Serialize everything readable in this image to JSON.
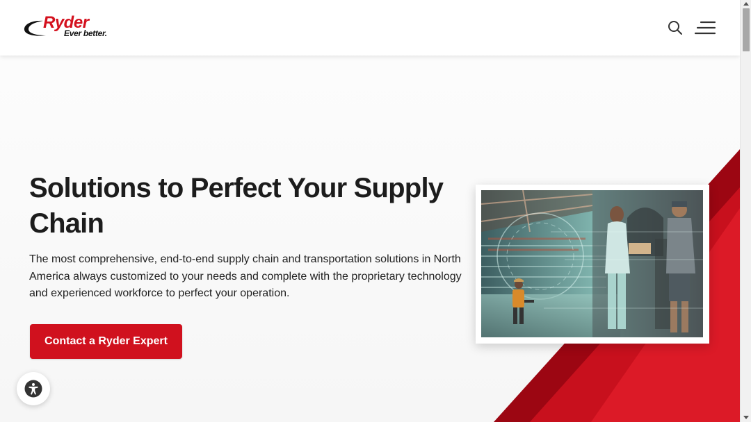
{
  "header": {
    "logo": {
      "wordmark": "Ryder",
      "tagline": "Ever better."
    },
    "icons": {
      "search": "search-icon",
      "menu": "menu-icon"
    }
  },
  "hero": {
    "title": "Solutions to Perfect Your Supply Chain",
    "description": "The most comprehensive, end-to-end supply chain and transportation solutions in North America always customized to your needs and complete with the proprietary technology and experienced workforce to perfect your operation.",
    "cta_label": "Contact a Ryder Expert"
  },
  "accessibility": {
    "icon": "accessibility-icon"
  },
  "colors": {
    "brand_red": "#d0111e",
    "dark_red": "#9e0712",
    "text": "#1c1c1c"
  }
}
